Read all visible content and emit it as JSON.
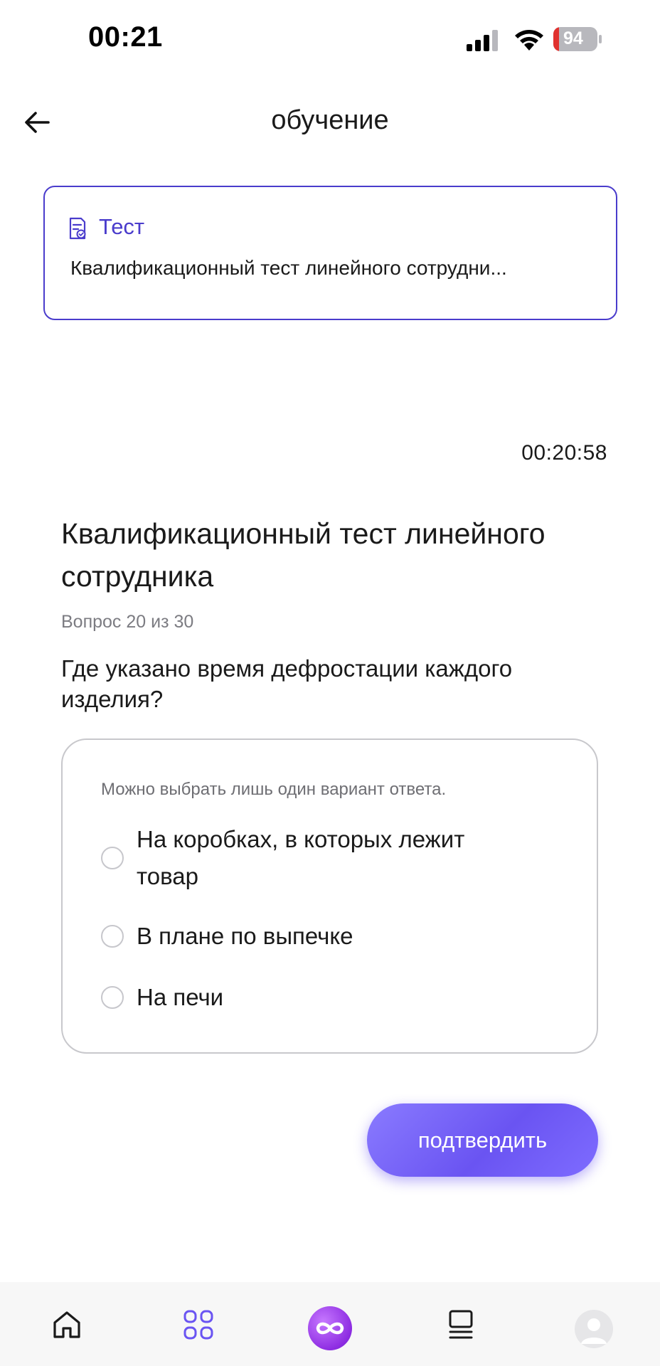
{
  "status_bar": {
    "time": "00:21",
    "battery_level": "94"
  },
  "header": {
    "title": "обучение",
    "back_icon": "arrow-left-icon"
  },
  "test_card": {
    "tag_label": "Тест",
    "tag_icon": "document-check-icon",
    "title": "Квалификационный тест линейного сотрудни..."
  },
  "timer": "00:20:58",
  "quiz": {
    "title": "Квалификационный тест линейного сотрудника",
    "counter": "Вопрос 20 из 30",
    "question": "Где указано время дефростации каждого изделия?",
    "hint": "Можно выбрать лишь один вариант ответа.",
    "options": [
      {
        "label": "На коробках, в которых лежит товар",
        "selected": false
      },
      {
        "label": "В плане по выпечке",
        "selected": false
      },
      {
        "label": "На печи",
        "selected": false
      }
    ],
    "confirm_label": "подтвердить"
  },
  "bottom_nav": {
    "items": [
      {
        "icon": "home-icon"
      },
      {
        "icon": "grid-icon"
      },
      {
        "icon": "infinity-logo-icon"
      },
      {
        "icon": "stack-icon"
      },
      {
        "icon": "profile-avatar"
      }
    ]
  },
  "colors": {
    "accent": "#4a3ccc",
    "button": "#7563f5",
    "border": "#c8c8cc"
  }
}
